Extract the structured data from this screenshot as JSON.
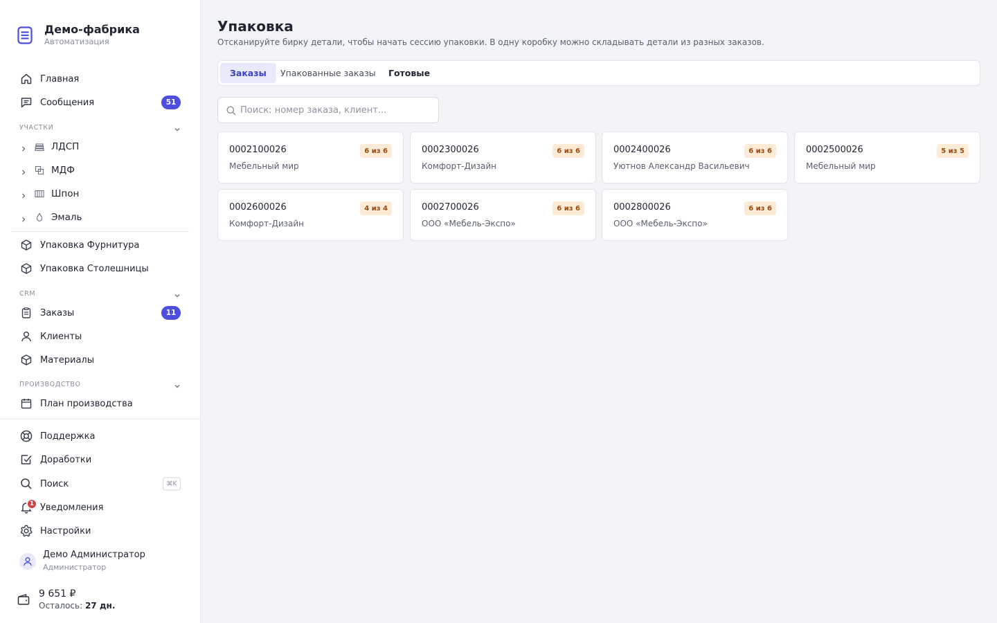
{
  "brand": {
    "title": "Демо-фабрика",
    "subtitle": "Автоматизация"
  },
  "nav": {
    "home": "Главная",
    "messages": "Сообщения",
    "messages_badge": "51",
    "sections_title": "УЧАСТКИ",
    "sections": [
      "ЛДСП",
      "МДФ",
      "Шпон",
      "Эмаль"
    ],
    "packing_hardware": "Упаковка Фурнитура",
    "packing_countertops": "Упаковка Столешницы",
    "crm_title": "CRM",
    "orders": "Заказы",
    "orders_badge": "11",
    "clients": "Клиенты",
    "materials": "Материалы",
    "production_title": "ПРОИЗВОДСТВО",
    "production_plan": "План производства",
    "support": "Поддержка",
    "improvements": "Доработки",
    "search": "Поиск",
    "search_shortcut": "⌘K",
    "notifications": "Уведомления",
    "notifications_count": "1",
    "settings": "Настройки"
  },
  "user": {
    "name": "Демо Администратор",
    "role": "Администратор"
  },
  "balance": {
    "amount": "9 651 ₽",
    "left_label": "Осталось:",
    "left_value": "27 дн."
  },
  "page": {
    "title": "Упаковка",
    "subtitle": "Отсканируйте бирку детали, чтобы начать сессию упаковки. В одну коробку можно складывать детали из разных заказов."
  },
  "tabs": [
    "Заказы",
    "Упакованные заказы",
    "Готовые"
  ],
  "search": {
    "placeholder": "Поиск: номер заказа, клиент..."
  },
  "orders": [
    {
      "number": "0002100026",
      "client": "Мебельный мир",
      "progress": "6 из 6"
    },
    {
      "number": "0002300026",
      "client": "Комфорт-Дизайн",
      "progress": "6 из 6"
    },
    {
      "number": "0002400026",
      "client": "Уютнов Александр Васильевич",
      "progress": "6 из 6"
    },
    {
      "number": "0002500026",
      "client": "Мебельный мир",
      "progress": "5 из 5"
    },
    {
      "number": "0002600026",
      "client": "Комфорт-Дизайн",
      "progress": "4 из 4"
    },
    {
      "number": "0002700026",
      "client": "ООО «Мебель-Экспо»",
      "progress": "6 из 6"
    },
    {
      "number": "0002800026",
      "client": "ООО «Мебель-Экспо»",
      "progress": "6 из 6"
    }
  ],
  "colors": {
    "accent": "#4b4ede",
    "badge_bg": "#fdebd6",
    "badge_text": "#9a4a12",
    "notification": "#d64040"
  }
}
